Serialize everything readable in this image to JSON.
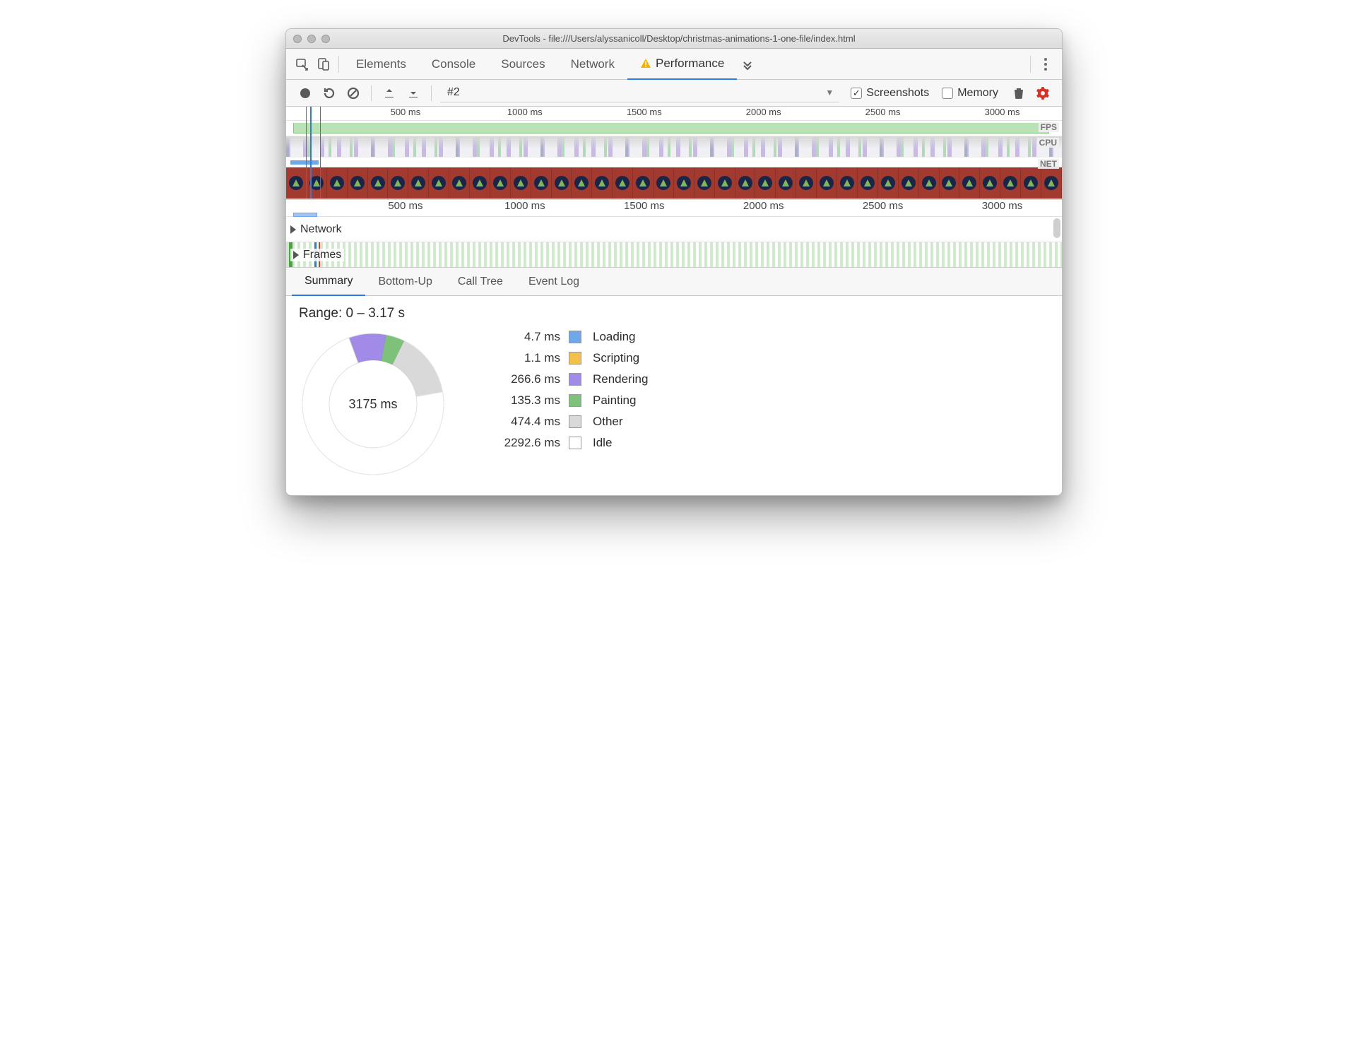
{
  "window": {
    "title": "DevTools - file:///Users/alyssanicoll/Desktop/christmas-animations-1-one-file/index.html"
  },
  "main_tabs": {
    "items": [
      "Elements",
      "Console",
      "Sources",
      "Network",
      "Performance"
    ],
    "active_index": 4,
    "show_warning_on_active": true
  },
  "perf_toolbar": {
    "recording_selector": "#2",
    "screenshots_checked": true,
    "memory_checked": false,
    "screenshots_label": "Screenshots",
    "memory_label": "Memory"
  },
  "overview": {
    "ruler_ticks": [
      "500 ms",
      "1000 ms",
      "1500 ms",
      "2000 ms",
      "2500 ms",
      "3000 ms"
    ],
    "lanes": {
      "fps": "FPS",
      "cpu": "CPU",
      "net": "NET"
    },
    "filmstrip_count": 38
  },
  "tracks": {
    "ruler_ticks": [
      "500 ms",
      "1000 ms",
      "1500 ms",
      "2000 ms",
      "2500 ms",
      "3000 ms"
    ],
    "rows": [
      {
        "label": "Network"
      },
      {
        "label": "Frames"
      }
    ]
  },
  "bottom_tabs": {
    "items": [
      "Summary",
      "Bottom-Up",
      "Call Tree",
      "Event Log"
    ],
    "active_index": 0
  },
  "summary": {
    "range_label": "Range: 0 – 3.17 s",
    "center_label": "3175 ms",
    "legend": [
      {
        "value": "4.7 ms",
        "label": "Loading",
        "color": "#6ea8e8"
      },
      {
        "value": "1.1 ms",
        "label": "Scripting",
        "color": "#f3c04b"
      },
      {
        "value": "266.6 ms",
        "label": "Rendering",
        "color": "#a28ae8"
      },
      {
        "value": "135.3 ms",
        "label": "Painting",
        "color": "#7ec17a"
      },
      {
        "value": "474.4 ms",
        "label": "Other",
        "color": "#d9d9d9"
      },
      {
        "value": "2292.6 ms",
        "label": "Idle",
        "color": "#ffffff"
      }
    ]
  },
  "chart_data": {
    "type": "pie",
    "title": "Time breakdown",
    "total_ms": 3175,
    "series": [
      {
        "name": "Loading",
        "value": 4.7,
        "color": "#6ea8e8"
      },
      {
        "name": "Scripting",
        "value": 1.1,
        "color": "#f3c04b"
      },
      {
        "name": "Rendering",
        "value": 266.6,
        "color": "#a28ae8"
      },
      {
        "name": "Painting",
        "value": 135.3,
        "color": "#7ec17a"
      },
      {
        "name": "Other",
        "value": 474.4,
        "color": "#d9d9d9"
      },
      {
        "name": "Idle",
        "value": 2292.6,
        "color": "#ffffff"
      }
    ]
  }
}
